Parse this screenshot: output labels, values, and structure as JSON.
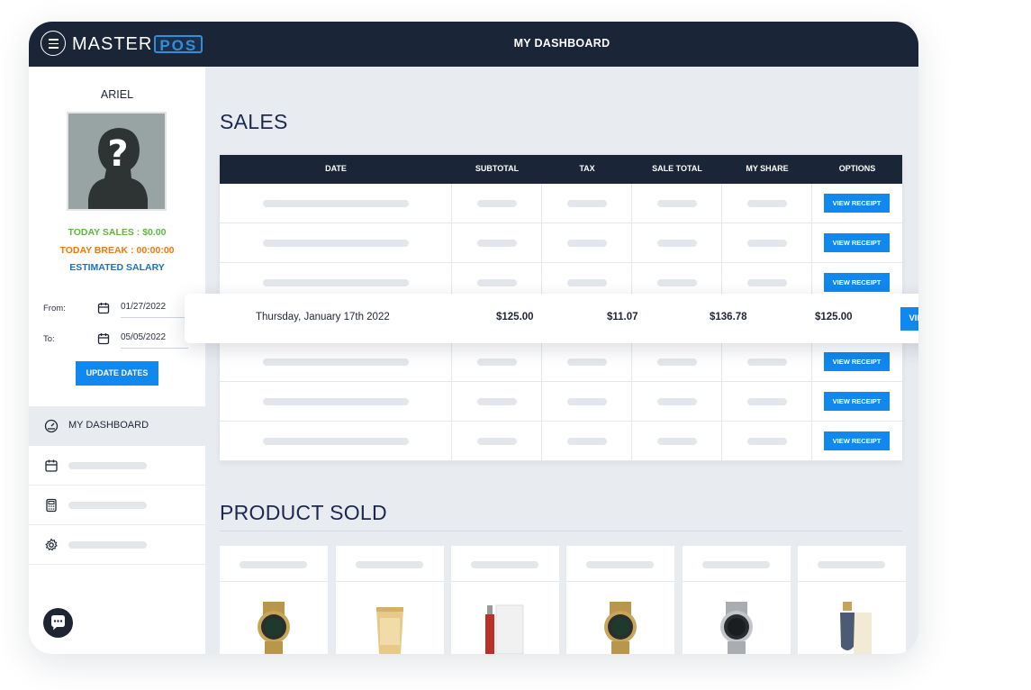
{
  "app": {
    "logo_part1": "MASTER",
    "logo_part2": "POS",
    "page_title": "MY DASHBOARD",
    "menu_icon": "hamburger-menu-icon"
  },
  "sidebar": {
    "user_name": "ARIEL",
    "avatar_icon": "unknown-person-icon",
    "today_sales": "TODAY SALES : $0.00",
    "today_break": "TODAY BREAK : 00:00:00",
    "estimated_salary": "ESTIMATED SALARY",
    "from_label": "From:",
    "from_date": "01/27/2022",
    "to_label": "To:",
    "to_date": "05/05/2022",
    "update_button": "UPDATE DATES",
    "nav": [
      {
        "label": "MY DASHBOARD",
        "icon": "dashboard-gauge-icon",
        "active": true
      },
      {
        "label": "",
        "icon": "calendar-icon"
      },
      {
        "label": "",
        "icon": "calculator-icon"
      },
      {
        "label": "",
        "icon": "gear-icon"
      }
    ],
    "chat_icon": "chat-bubble-icon"
  },
  "colors": {
    "navy": "#1b2538",
    "accent_blue": "#1088ee",
    "sales_green": "#5bb83a",
    "break_orange": "#f0780a",
    "salary_blue": "#1673c4",
    "title_navy": "#1c2850"
  },
  "sales": {
    "title": "SALES",
    "columns": [
      "DATE",
      "SUBTOTAL",
      "TAX",
      "SALE TOTAL",
      "MY SHARE",
      "OPTIONS"
    ],
    "row_button": "VIEW RECEIPT",
    "highlighted_row": {
      "date": "Thursday, January 17th 2022",
      "subtotal": "$125.00",
      "tax": "$11.07",
      "sale_total": "$136.78",
      "my_share": "$125.00",
      "button": "VIEW RECEIPT"
    }
  },
  "products": {
    "title": "PRODUCT SOLD",
    "items": [
      {
        "image": "gold-watch-icon"
      },
      {
        "image": "cream-tube-icon"
      },
      {
        "image": "perfume-box-icon"
      },
      {
        "image": "gold-watch-icon"
      },
      {
        "image": "silver-watch-icon"
      },
      {
        "image": "serum-bottle-icon"
      }
    ]
  }
}
